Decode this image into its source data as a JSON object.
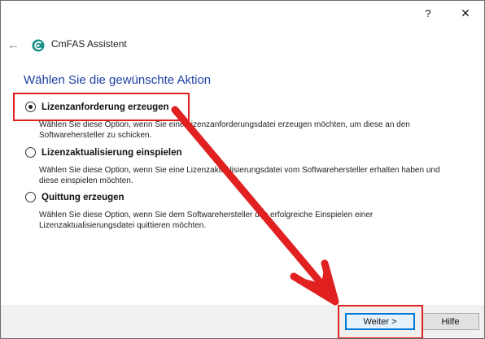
{
  "titlebar": {
    "help_glyph": "?",
    "close_glyph": "✕"
  },
  "header": {
    "back_glyph": "←",
    "app_title": "CmFAS Assistent"
  },
  "heading": "Wählen Sie die gewünschte Aktion",
  "options": [
    {
      "label": "Lizenzanforderung erzeugen",
      "checked": true,
      "desc_line1": "Wählen Sie diese Option, wenn Sie eine Lizenzanforderungsdatei erzeugen möchten, um diese an den",
      "desc_line2": "Softwarehersteller zu schicken."
    },
    {
      "label": "Lizenzaktualisierung einspielen",
      "checked": false,
      "desc_line1": "Wählen Sie diese Option, wenn Sie eine Lizenzaktualisierungsdatei vom Softwarehersteller erhalten haben und",
      "desc_line2": "diese einspielen möchten."
    },
    {
      "label": "Quittung erzeugen",
      "checked": false,
      "desc_line1": "Wählen Sie diese Option, wenn Sie dem Softwarehersteller das erfolgreiche Einspielen einer",
      "desc_line2": "Lizenzaktualisierungsdatei quittieren möchten."
    }
  ],
  "footer": {
    "next_label": "Weiter >",
    "help_label": "Hilfe"
  },
  "colors": {
    "heading": "#1c3fa3",
    "highlight": "#e12020",
    "primary_border": "#0078d7",
    "footer_bg": "#f0f0f0"
  }
}
